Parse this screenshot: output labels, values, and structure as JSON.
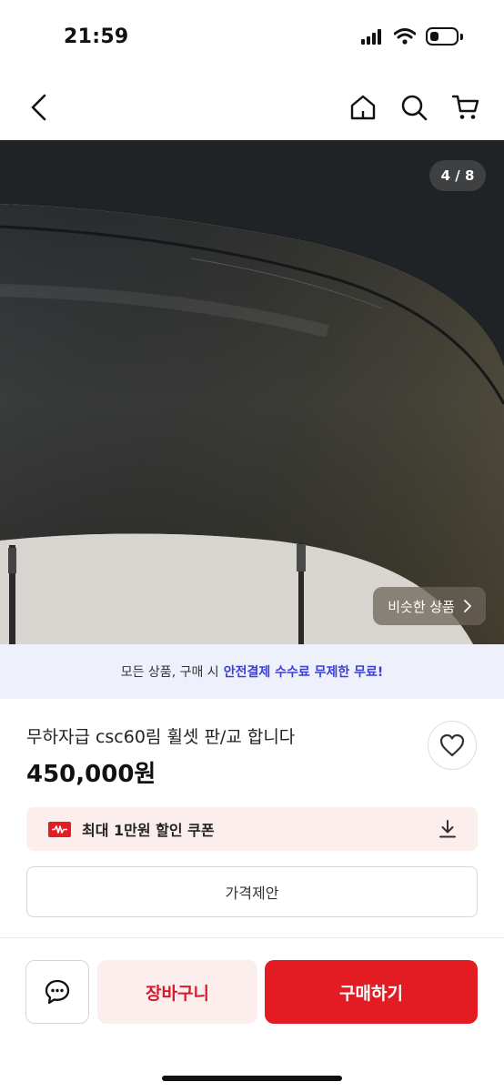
{
  "status_bar": {
    "time": "21:59"
  },
  "product_image": {
    "counter": "4 / 8",
    "similar_label": "비슷한 상품"
  },
  "promo": {
    "prefix": "모든 상품, 구매 시",
    "highlight": "안전결제 수수료 무제한 무료!"
  },
  "product": {
    "title": "무하자급 csc60림 휠셋 판/교 합니다",
    "price": "450,000원"
  },
  "coupon": {
    "label": "최대 1만원 할인 쿠폰"
  },
  "offer": {
    "label": "가격제안"
  },
  "actions": {
    "cart_label": "장바구니",
    "buy_label": "구매하기"
  },
  "colors": {
    "accent": "#e31b23",
    "promo_bg": "#eef0fb",
    "promo_highlight": "#3b3fd6",
    "soft_red": "#fdeeee"
  }
}
